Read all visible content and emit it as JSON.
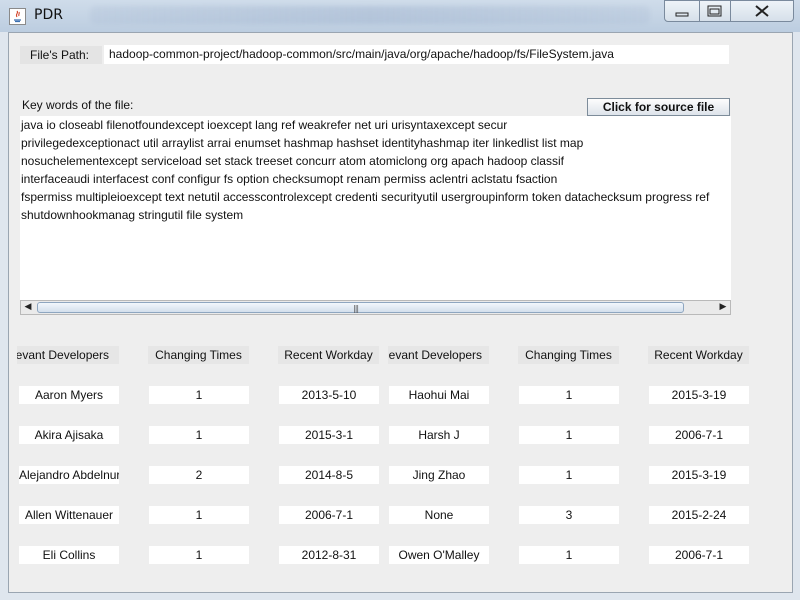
{
  "window": {
    "title": "PDR",
    "controls": {
      "minimize_icon": "minimize-icon",
      "maximize_icon": "maximize-icon",
      "close_icon": "close-icon"
    }
  },
  "file_path": {
    "label": "File's Path:",
    "value": "hadoop-common-project/hadoop-common/src/main/java/org/apache/hadoop/fs/FileSystem.java"
  },
  "keywords": {
    "label": "Key words of the file:",
    "button_label": "Click for source file",
    "lines": [
      "java io closeabl filenotfoundexcept ioexcept lang ref weakrefer net uri urisyntaxexcept secur",
      "privilegedexceptionact util arraylist arrai enumset hashmap hashset identityhashmap iter linkedlist list map",
      "nosuchelementexcept serviceload set stack treeset concurr atom atomiclong org apach hadoop classif",
      "interfaceaudi interfacest conf configur fs option checksumopt renam permiss aclentri aclstatu fsaction",
      "fspermiss multipleioexcept text netutil accesscontrolexcept credenti securityutil usergroupinform token datachecksum progress ref",
      "shutdownhookmanag stringutil file system"
    ]
  },
  "table": {
    "headers": [
      "levant Developers",
      "Changing Times",
      "Recent Workday",
      "levant Developers",
      "Changing Times",
      "Recent Workday"
    ],
    "rows": [
      [
        "Aaron Myers",
        "1",
        "2013-5-10",
        "Haohui Mai",
        "1",
        "2015-3-19"
      ],
      [
        "Akira Ajisaka",
        "1",
        "2015-3-1",
        "Harsh J",
        "1",
        "2006-7-1"
      ],
      [
        "Alejandro Abdelnur",
        "2",
        "2014-8-5",
        "Jing Zhao",
        "1",
        "2015-3-19"
      ],
      [
        "Allen Wittenauer",
        "1",
        "2006-7-1",
        "None",
        "3",
        "2015-2-24"
      ],
      [
        "Eli Collins",
        "1",
        "2012-8-31",
        "Owen O'Malley",
        "1",
        "2006-7-1"
      ]
    ]
  }
}
